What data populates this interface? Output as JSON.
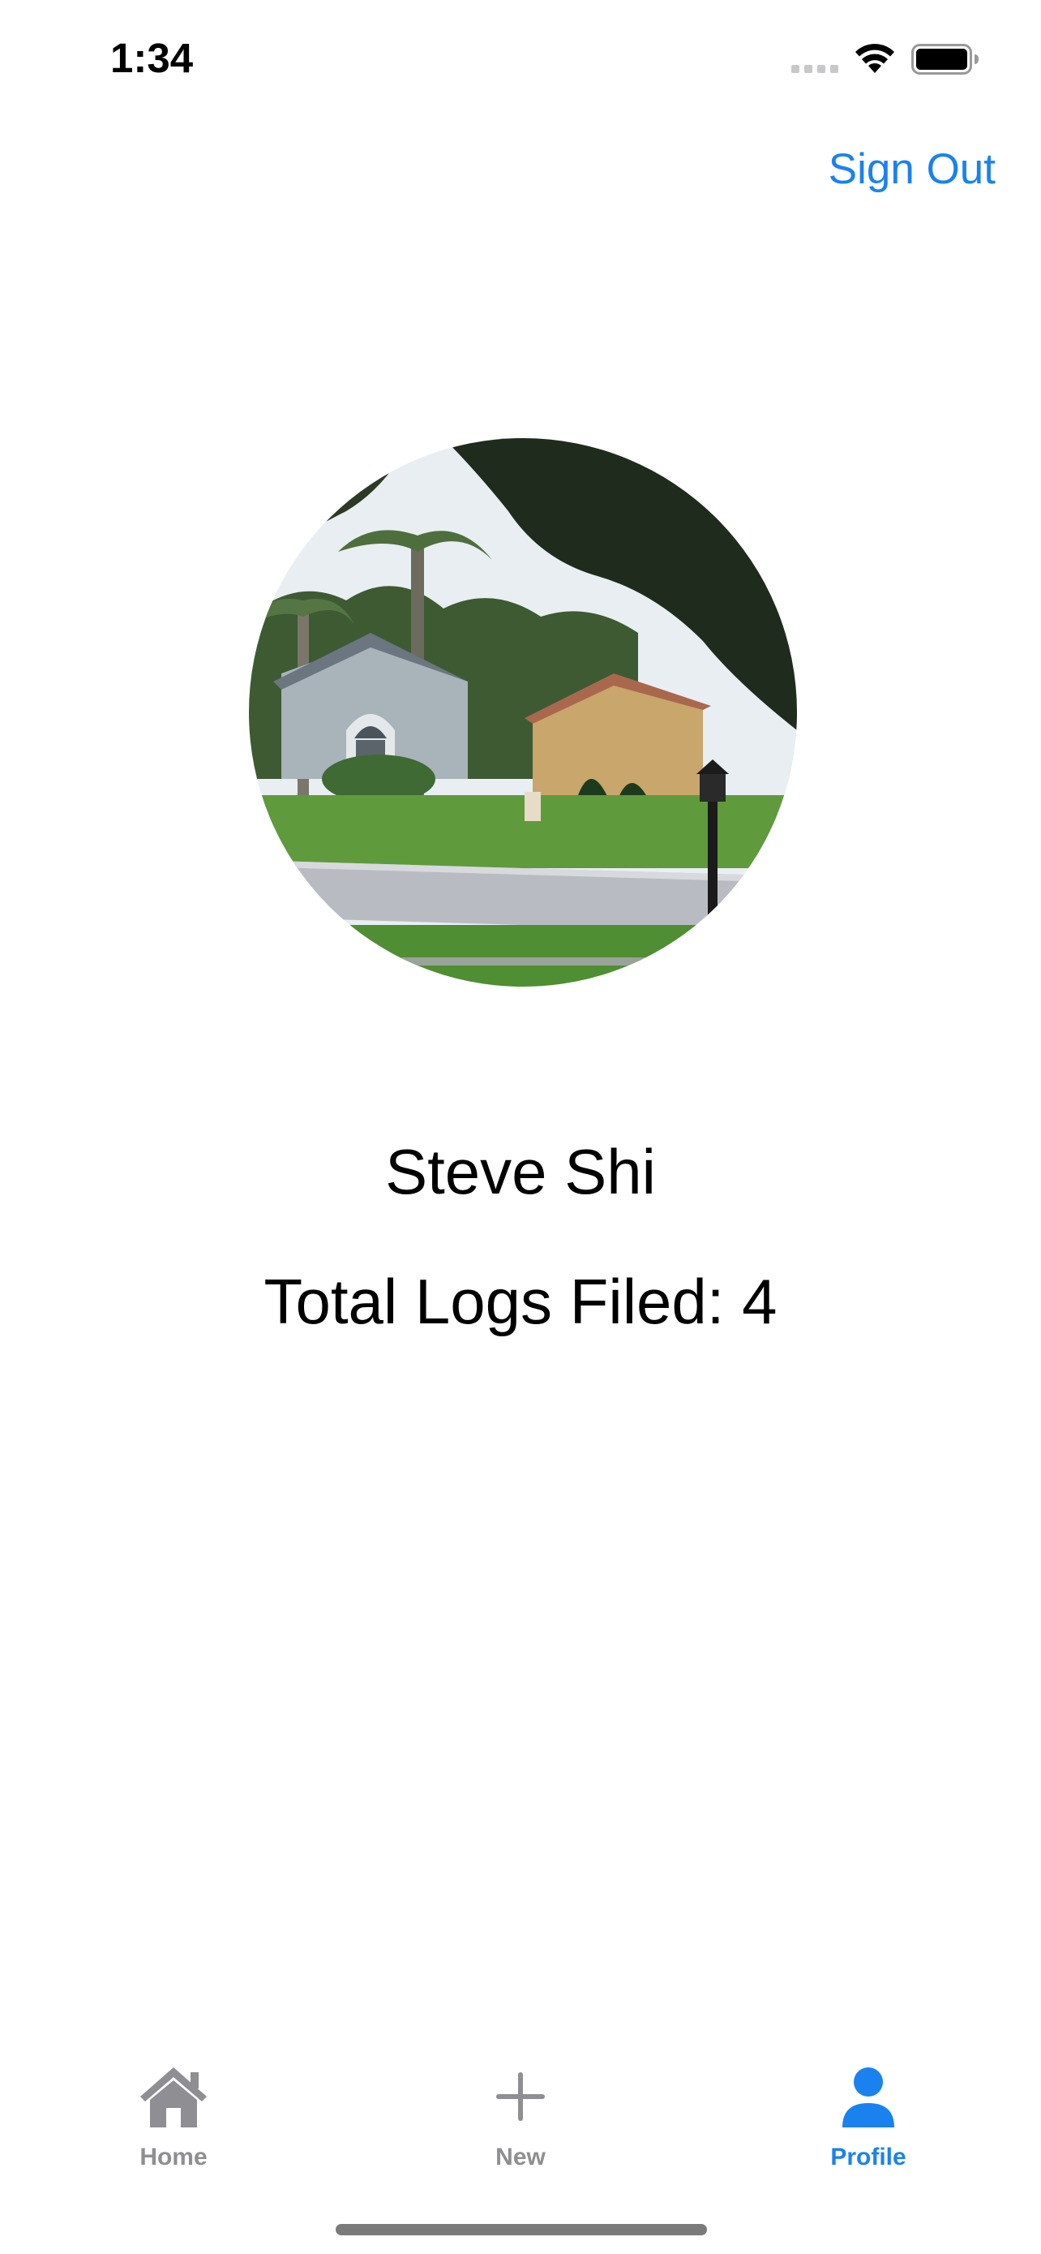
{
  "status_bar": {
    "time": "1:34"
  },
  "header": {
    "sign_out_label": "Sign Out"
  },
  "profile": {
    "name": "Steve Shi",
    "total_logs_text": "Total Logs Filed: 4"
  },
  "tab_bar": {
    "tabs": [
      {
        "label": "Home",
        "icon": "house-icon",
        "selected": false
      },
      {
        "label": "New",
        "icon": "plus-icon",
        "selected": false
      },
      {
        "label": "Profile",
        "icon": "person-icon",
        "selected": true
      }
    ]
  },
  "colors": {
    "accent": "#1a82ee",
    "inactive_tab": "#8e8e93",
    "background": "#ffffff"
  }
}
